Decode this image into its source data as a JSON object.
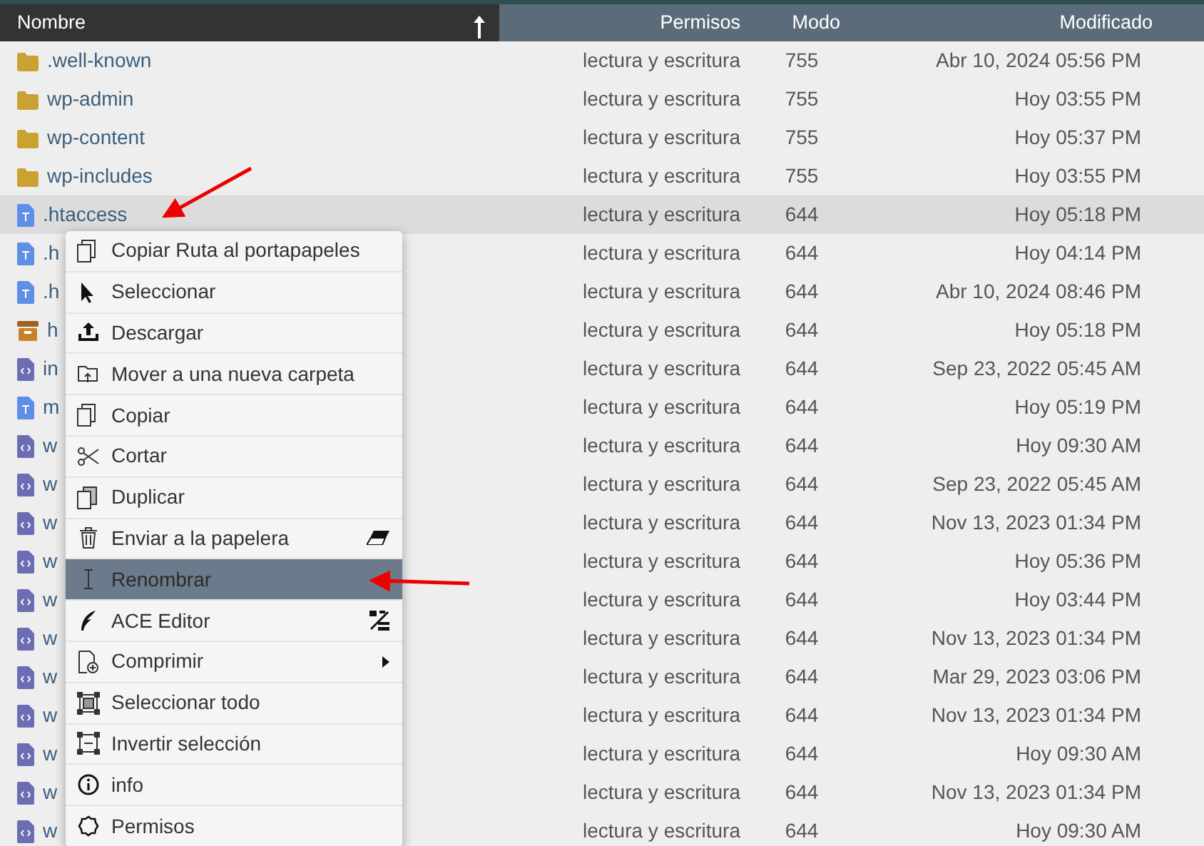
{
  "table": {
    "columns": [
      {
        "label": "Nombre",
        "sorted": true
      },
      {
        "label": "Permisos",
        "sorted": false
      },
      {
        "label": "Modo",
        "sorted": false
      },
      {
        "label": "Modificado",
        "sorted": false
      }
    ],
    "rows": [
      {
        "kind": "folder",
        "name": ".well-known",
        "permissions": "lectura y escritura",
        "mode": "755",
        "modified": "Abr 10, 2024 05:56 PM",
        "selected": false
      },
      {
        "kind": "folder",
        "name": "wp-admin",
        "permissions": "lectura y escritura",
        "mode": "755",
        "modified": "Hoy 03:55 PM",
        "selected": false
      },
      {
        "kind": "folder",
        "name": "wp-content",
        "permissions": "lectura y escritura",
        "mode": "755",
        "modified": "Hoy 05:37 PM",
        "selected": false
      },
      {
        "kind": "folder",
        "name": "wp-includes",
        "permissions": "lectura y escritura",
        "mode": "755",
        "modified": "Hoy 03:55 PM",
        "selected": false
      },
      {
        "kind": "text",
        "name": ".htaccess",
        "permissions": "lectura y escritura",
        "mode": "644",
        "modified": "Hoy 05:18 PM",
        "selected": true
      },
      {
        "kind": "text",
        "name": ".h",
        "permissions": "lectura y escritura",
        "mode": "644",
        "modified": "Hoy 04:14 PM",
        "selected": false
      },
      {
        "kind": "text",
        "name": ".h",
        "permissions": "lectura y escritura",
        "mode": "644",
        "modified": "Abr 10, 2024 08:46 PM",
        "selected": false
      },
      {
        "kind": "archive",
        "name": "h",
        "permissions": "lectura y escritura",
        "mode": "644",
        "modified": "Hoy 05:18 PM",
        "selected": false
      },
      {
        "kind": "code",
        "name": "in",
        "permissions": "lectura y escritura",
        "mode": "644",
        "modified": "Sep 23, 2022 05:45 AM",
        "selected": false
      },
      {
        "kind": "text",
        "name": "m",
        "permissions": "lectura y escritura",
        "mode": "644",
        "modified": "Hoy 05:19 PM",
        "selected": false
      },
      {
        "kind": "code",
        "name": "w",
        "permissions": "lectura y escritura",
        "mode": "644",
        "modified": "Hoy 09:30 AM",
        "selected": false
      },
      {
        "kind": "code",
        "name": "w",
        "permissions": "lectura y escritura",
        "mode": "644",
        "modified": "Sep 23, 2022 05:45 AM",
        "selected": false
      },
      {
        "kind": "code",
        "name": "w",
        "permissions": "lectura y escritura",
        "mode": "644",
        "modified": "Nov 13, 2023 01:34 PM",
        "selected": false
      },
      {
        "kind": "code",
        "name": "w",
        "permissions": "lectura y escritura",
        "mode": "644",
        "modified": "Hoy 05:36 PM",
        "selected": false
      },
      {
        "kind": "code",
        "name": "w",
        "permissions": "lectura y escritura",
        "mode": "644",
        "modified": "Hoy 03:44 PM",
        "selected": false
      },
      {
        "kind": "code",
        "name": "w",
        "permissions": "lectura y escritura",
        "mode": "644",
        "modified": "Nov 13, 2023 01:34 PM",
        "selected": false
      },
      {
        "kind": "code",
        "name": "w",
        "permissions": "lectura y escritura",
        "mode": "644",
        "modified": "Mar 29, 2023 03:06 PM",
        "selected": false
      },
      {
        "kind": "code",
        "name": "w",
        "permissions": "lectura y escritura",
        "mode": "644",
        "modified": "Nov 13, 2023 01:34 PM",
        "selected": false
      },
      {
        "kind": "code",
        "name": "w",
        "permissions": "lectura y escritura",
        "mode": "644",
        "modified": "Hoy 09:30 AM",
        "selected": false
      },
      {
        "kind": "code",
        "name": "w",
        "permissions": "lectura y escritura",
        "mode": "644",
        "modified": "Nov 13, 2023 01:34 PM",
        "selected": false
      },
      {
        "kind": "code",
        "name": "w",
        "permissions": "lectura y escritura",
        "mode": "644",
        "modified": "Hoy 09:30 AM",
        "selected": false
      }
    ]
  },
  "context_menu": {
    "items": [
      {
        "label": "Copiar Ruta al portapapeles",
        "selected": false
      },
      {
        "label": "Seleccionar",
        "selected": false
      },
      {
        "label": "Descargar",
        "selected": false
      },
      {
        "label": "Mover a una nueva carpeta",
        "selected": false
      },
      {
        "label": "Copiar",
        "selected": false
      },
      {
        "label": "Cortar",
        "selected": false
      },
      {
        "label": "Duplicar",
        "selected": false
      },
      {
        "label": "Enviar a la papelera",
        "selected": false,
        "kind": "shortcut"
      },
      {
        "label": "Renombrar",
        "selected": true
      },
      {
        "label": "ACE Editor",
        "selected": false,
        "kind": "shortcut"
      },
      {
        "label": "Comprimir",
        "selected": false,
        "kind": "submenu"
      },
      {
        "label": "Seleccionar todo",
        "selected": false
      },
      {
        "label": "Invertir selección",
        "selected": false
      },
      {
        "label": "info",
        "selected": false
      },
      {
        "label": "Permisos",
        "selected": false
      }
    ]
  }
}
